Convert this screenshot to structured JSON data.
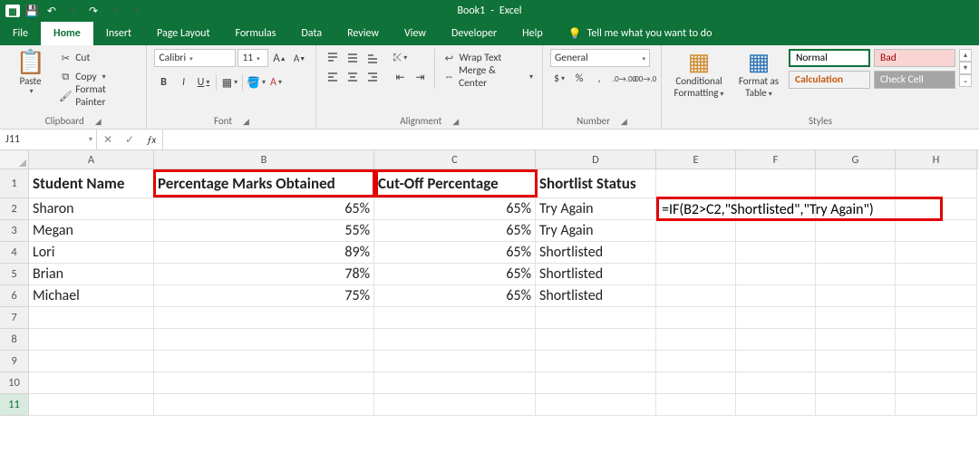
{
  "app": {
    "doc_name": "Book1",
    "app_name": "Excel"
  },
  "qat": {
    "save": "💾",
    "undo": "↶",
    "redo": "↷",
    "custom": "▾"
  },
  "tabs": {
    "file": "File",
    "home": "Home",
    "insert": "Insert",
    "page_layout": "Page Layout",
    "formulas": "Formulas",
    "data": "Data",
    "review": "Review",
    "view": "View",
    "developer": "Developer",
    "help": "Help",
    "tellme": "Tell me what you want to do"
  },
  "ribbon": {
    "clipboard": {
      "label": "Clipboard",
      "paste": "Paste",
      "cut": "Cut",
      "copy": "Copy",
      "fp": "Format Painter"
    },
    "font": {
      "label": "Font",
      "name": "Calibri",
      "size": "11",
      "inc": "A",
      "dec": "A"
    },
    "alignment": {
      "label": "Alignment",
      "wrap": "Wrap Text",
      "merge": "Merge & Center"
    },
    "number": {
      "label": "Number",
      "format": "General"
    },
    "cfmt": {
      "cond": "Conditional",
      "cond2": "Formatting",
      "table": "Format as",
      "table2": "Table"
    },
    "styles": {
      "label": "Styles",
      "normal": "Normal",
      "bad": "Bad",
      "calc": "Calculation",
      "check": "Check Cell"
    }
  },
  "fx": {
    "namebox": "J11",
    "formula": ""
  },
  "cols": [
    "A",
    "B",
    "C",
    "D",
    "E",
    "F",
    "G",
    "H"
  ],
  "headers": {
    "A": "Student Name",
    "B": "Percentage Marks Obtained",
    "C": "Cut-Off Percentage",
    "D": "Shortlist Status"
  },
  "rows_data": [
    {
      "A": "Sharon",
      "B": "65%",
      "C": "65%",
      "D": "Try Again"
    },
    {
      "A": "Megan",
      "B": "55%",
      "C": "65%",
      "D": "Try Again"
    },
    {
      "A": "Lori",
      "B": "89%",
      "C": "65%",
      "D": "Shortlisted"
    },
    {
      "A": "Brian",
      "B": "78%",
      "C": "65%",
      "D": "Shortlisted"
    },
    {
      "A": "Michael",
      "B": "75%",
      "C": "65%",
      "D": "Shortlisted"
    }
  ],
  "formula_annotation": "=IF(B2>C2,\"Shortlisted\",\"Try Again\")",
  "chart_data": {
    "type": "table",
    "title": "",
    "columns": [
      "Student Name",
      "Percentage Marks Obtained",
      "Cut-Off Percentage",
      "Shortlist Status"
    ],
    "rows": [
      [
        "Sharon",
        0.65,
        0.65,
        "Try Again"
      ],
      [
        "Megan",
        0.55,
        0.65,
        "Try Again"
      ],
      [
        "Lori",
        0.89,
        0.65,
        "Shortlisted"
      ],
      [
        "Brian",
        0.78,
        0.65,
        "Shortlisted"
      ],
      [
        "Michael",
        0.75,
        0.65,
        "Shortlisted"
      ]
    ]
  }
}
